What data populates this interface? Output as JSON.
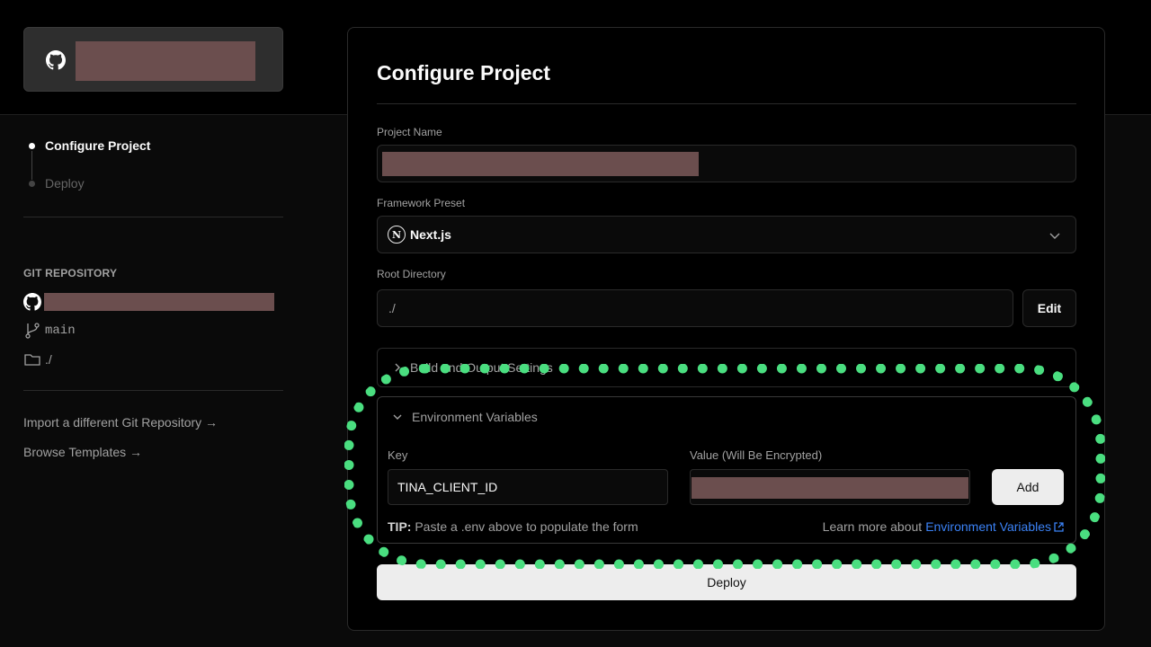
{
  "colors": {
    "highlight": "#4ade80",
    "link": "#3b82f6"
  },
  "sidebar": {
    "steps": [
      {
        "label": "Configure Project",
        "active": true
      },
      {
        "label": "Deploy",
        "active": false
      }
    ],
    "git_heading": "GIT REPOSITORY",
    "branch": "main",
    "directory": "./",
    "links": [
      "Import a different Git Repository →",
      "Browse Templates →"
    ]
  },
  "main": {
    "title": "Configure Project",
    "project_name_label": "Project Name",
    "framework_label": "Framework Preset",
    "framework_value": "Next.js",
    "framework_logo": "N",
    "root_label": "Root Directory",
    "root_value": "./",
    "edit_label": "Edit",
    "build_label": "Build and Output Settings",
    "env": {
      "title": "Environment Variables",
      "key_label": "Key",
      "value_label": "Value (Will Be Encrypted)",
      "key_value": "TINA_CLIENT_ID",
      "add_label": "Add",
      "tip_bold": "TIP:",
      "tip_text": " Paste a .env above to populate the form",
      "learn_text": "Learn more about",
      "learn_link": "Environment Variables"
    },
    "deploy_label": "Deploy"
  }
}
